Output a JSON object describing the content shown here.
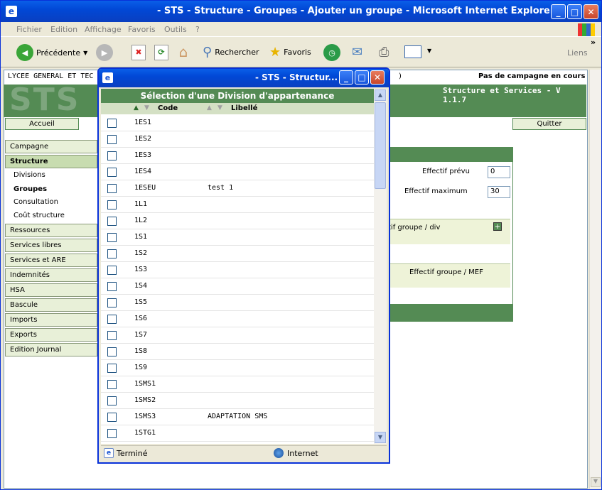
{
  "window": {
    "title": "- STS - Structure - Groupes - Ajouter un groupe - Microsoft Internet Explorer",
    "btn_min": "_",
    "btn_max": "□",
    "btn_close": "✕"
  },
  "menubar": {
    "items": [
      "Fichier",
      "Edition",
      "Affichage",
      "Favoris",
      "Outils",
      "?"
    ]
  },
  "toolbar": {
    "back": "Précédente",
    "search": "Rechercher",
    "favorites": "Favoris",
    "links": "Liens",
    "chevron": "»"
  },
  "page": {
    "school": "LYCEE GENERAL ET TEC",
    "campaign": "Pas de campagne en cours",
    "campaign_tail": ")",
    "logo": "STS",
    "version": "Structure et Services - V 1.1.7",
    "nav_home": "Accueil",
    "nav_quit": "Quitter",
    "sidebar": {
      "campagne": "Campagne",
      "structure": "Structure",
      "subs": [
        "Divisions",
        "Groupes",
        "Consultation",
        "Coût structure"
      ],
      "items": [
        "Ressources",
        "Services libres",
        "Services et ARE",
        "Indemnités",
        "HSA",
        "Bascule",
        "Imports",
        "Exports",
        "Edition Journal"
      ]
    },
    "form": {
      "effectif_prevu_label": "Effectif prévu",
      "effectif_prevu": "0",
      "effectif_max_label": "Effectif maximum",
      "effectif_max": "30",
      "groupe_div": "tif groupe / div",
      "groupe_mef": "Effectif groupe / MEF",
      "plus": "+"
    }
  },
  "popup": {
    "title": "- STS - Structur...",
    "heading": "Sélection d'une Division d'appartenance",
    "col_code": "Code",
    "col_libelle": "Libellé",
    "rows": [
      {
        "code": "1ES1",
        "lib": ""
      },
      {
        "code": "1ES2",
        "lib": ""
      },
      {
        "code": "1ES3",
        "lib": ""
      },
      {
        "code": "1ES4",
        "lib": ""
      },
      {
        "code": "1ESEU",
        "lib": "test 1"
      },
      {
        "code": "1L1",
        "lib": ""
      },
      {
        "code": "1L2",
        "lib": ""
      },
      {
        "code": "1S1",
        "lib": ""
      },
      {
        "code": "1S2",
        "lib": ""
      },
      {
        "code": "1S3",
        "lib": ""
      },
      {
        "code": "1S4",
        "lib": ""
      },
      {
        "code": "1S5",
        "lib": ""
      },
      {
        "code": "1S6",
        "lib": ""
      },
      {
        "code": "1S7",
        "lib": ""
      },
      {
        "code": "1S8",
        "lib": ""
      },
      {
        "code": "1S9",
        "lib": ""
      },
      {
        "code": "1SMS1",
        "lib": ""
      },
      {
        "code": "1SMS2",
        "lib": ""
      },
      {
        "code": "1SMS3",
        "lib": "ADAPTATION SMS"
      },
      {
        "code": "1STG1",
        "lib": ""
      }
    ],
    "status": "Terminé",
    "zone": "Internet"
  },
  "colors": {
    "xp_blue": "#0148D6",
    "sts_green": "#548B54",
    "panel": "#EEF3D8"
  }
}
